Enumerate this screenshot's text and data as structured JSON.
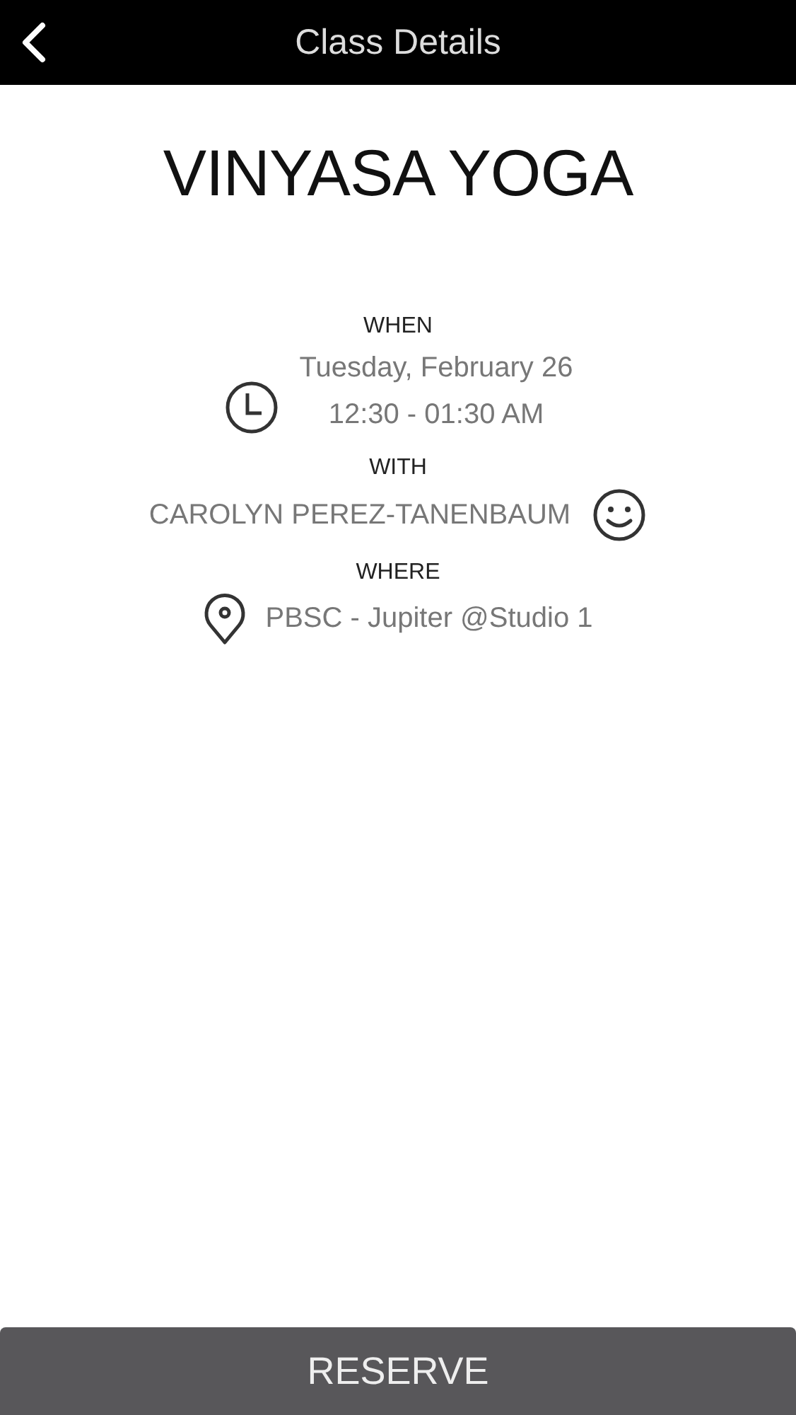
{
  "header": {
    "title": "Class Details"
  },
  "class_name": "VINYASA YOGA",
  "sections": [
    {
      "kind": "when",
      "label": "WHEN",
      "lines": [
        "Tuesday, February 26",
        "12:30 - 01:30 AM"
      ]
    },
    {
      "kind": "with",
      "label": "WITH",
      "lines": [
        "CAROLYN PEREZ-TANENBAUM"
      ]
    },
    {
      "kind": "where",
      "label": "WHERE",
      "lines": [
        "PBSC - Jupiter @Studio 1"
      ]
    }
  ],
  "button": "RESERVE"
}
